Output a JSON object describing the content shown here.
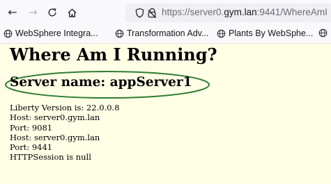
{
  "browser": {
    "url": {
      "scheme": "https://",
      "host_prefix": "server0.",
      "host_domain": "gym.lan",
      "port_path": ":9441/WhereAmI"
    },
    "bookmarks": [
      {
        "label": "WebSphere Integra..."
      },
      {
        "label": "Transformation Adv..."
      },
      {
        "label": "Plants By WebSphe..."
      }
    ]
  },
  "page": {
    "title": "Where Am I Running?",
    "server_name": "Server name: appServer1",
    "highlight_color": "#2e7d32",
    "lines": [
      "Liberty Version is: 22.0.0.8",
      "Host: server0.gym.lan",
      "Port: 9081",
      "Host: server0.gym.lan",
      "Port: 9441",
      "HTTPSession is null"
    ]
  },
  "colors": {
    "page_background": "#ffffe6",
    "chrome_background": "#f9f9fb",
    "url_bar_background": "#f0f0f4"
  }
}
